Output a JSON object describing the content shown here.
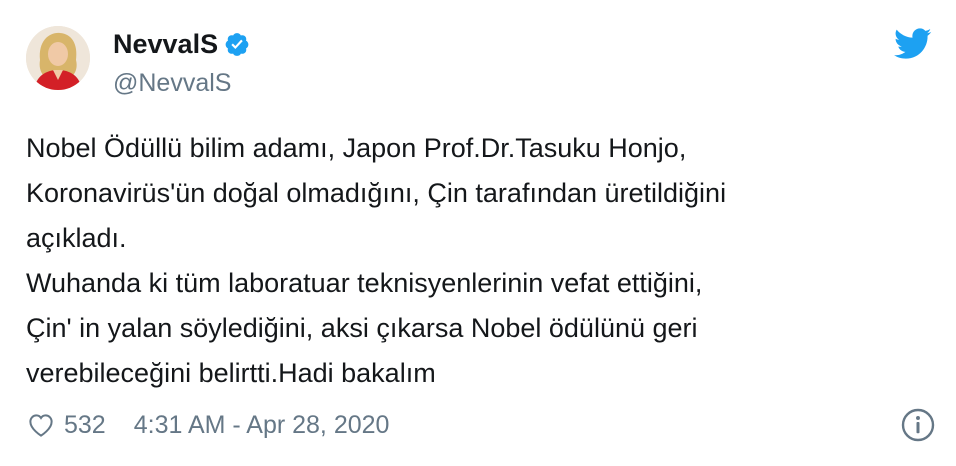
{
  "author": {
    "display_name": "NevvalS",
    "handle": "@NevvalS",
    "verified": true
  },
  "tweet": {
    "lines": [
      "Nobel Ödüllü bilim adamı, Japon Prof.Dr.Tasuku Honjo,",
      "Koronavirüs'ün doğal olmadığını, Çin tarafından üretildiğini",
      "açıkladı.",
      "Wuhanda ki tüm laboratuar teknisyenlerinin vefat ettiğini,",
      "Çin' in yalan söylediğini, aksi çıkarsa Nobel ödülünü geri",
      "verebileceğini belirtti.Hadi bakalım"
    ]
  },
  "footer": {
    "like_count": "532",
    "timestamp": "4:31 AM - Apr 28, 2020"
  },
  "icons": {
    "verified": "verified-badge-icon",
    "brand": "twitter-bird-icon",
    "like": "heart-icon",
    "info": "info-icon"
  },
  "colors": {
    "brand_blue": "#1da1f2",
    "text_primary": "#14171a",
    "text_secondary": "#657786"
  }
}
